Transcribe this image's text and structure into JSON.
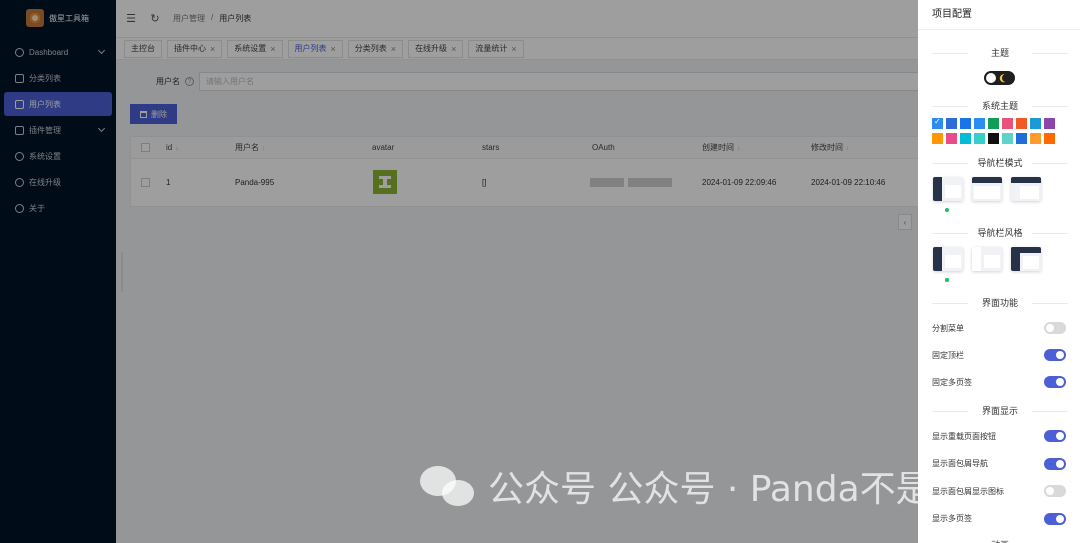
{
  "app": {
    "name": "傲星工具箱"
  },
  "sidebar": {
    "items": [
      {
        "label": "Dashboard",
        "icon": "dashboard-icon",
        "has_children": true,
        "active": false
      },
      {
        "label": "分类列表",
        "icon": "category-icon",
        "has_children": false,
        "active": false
      },
      {
        "label": "用户列表",
        "icon": "users-icon",
        "has_children": false,
        "active": true
      },
      {
        "label": "插件管理",
        "icon": "plugin-icon",
        "has_children": true,
        "active": false
      },
      {
        "label": "系统设置",
        "icon": "gear-icon",
        "has_children": false,
        "active": false
      },
      {
        "label": "在线升级",
        "icon": "cloud-icon",
        "has_children": false,
        "active": false
      },
      {
        "label": "关于",
        "icon": "info-icon",
        "has_children": false,
        "active": false
      }
    ]
  },
  "header": {
    "breadcrumb": [
      "用户管理",
      "/",
      "用户列表"
    ]
  },
  "tabs": [
    {
      "label": "主控台",
      "closable": false,
      "active": false
    },
    {
      "label": "插件中心",
      "closable": true,
      "active": false
    },
    {
      "label": "系统设置",
      "closable": true,
      "active": false
    },
    {
      "label": "用户列表",
      "closable": true,
      "active": true
    },
    {
      "label": "分类列表",
      "closable": true,
      "active": false
    },
    {
      "label": "在线升级",
      "closable": true,
      "active": false
    },
    {
      "label": "流量统计",
      "closable": true,
      "active": false
    }
  ],
  "search": {
    "label": "用户名",
    "placeholder": "请输入用户名",
    "value": ""
  },
  "toolbar": {
    "delete_label": "删除"
  },
  "table": {
    "columns": [
      "id",
      "用户名",
      "avatar",
      "stars",
      "OAuth",
      "创建时间",
      "修改时间"
    ],
    "rows": [
      {
        "id": "1",
        "username": "Panda-995",
        "stars": "[]",
        "created": "2024-01-09 22:09:46",
        "modified": "2024-01-09 22:10:46"
      }
    ]
  },
  "drawer": {
    "title": "项目配置",
    "theme_title": "主题",
    "system_theme_title": "系统主题",
    "nav_mode_title": "导航栏模式",
    "nav_style_title": "导航栏风格",
    "features_title": "界面功能",
    "display_title": "界面显示",
    "animation_title": "动画",
    "theme_colors_row1": [
      "#2d8cf0",
      "#2d6bd8",
      "#1a73e8",
      "#2d8cf0",
      "#0f9d58",
      "#e8537a",
      "#f15a24",
      "#1c9ad6",
      "#8e44ad"
    ],
    "theme_colors_row2": [
      "#ff9800",
      "#ea4c89",
      "#00bcd4",
      "#36cfc9",
      "#111111",
      "#5fd3c7",
      "#1e6fd9",
      "#ff9a2e",
      "#ff6a00"
    ],
    "features": [
      {
        "label": "分割菜单",
        "on": false
      },
      {
        "label": "固定顶栏",
        "on": true
      },
      {
        "label": "固定多页签",
        "on": true
      }
    ],
    "display": [
      {
        "label": "显示重载页面按钮",
        "on": true
      },
      {
        "label": "显示面包屑导航",
        "on": true
      },
      {
        "label": "显示面包屑显示图标",
        "on": false
      },
      {
        "label": "显示多页签",
        "on": true
      }
    ]
  },
  "watermark": {
    "text": "公众号 公众号 · Panda不是猫"
  }
}
